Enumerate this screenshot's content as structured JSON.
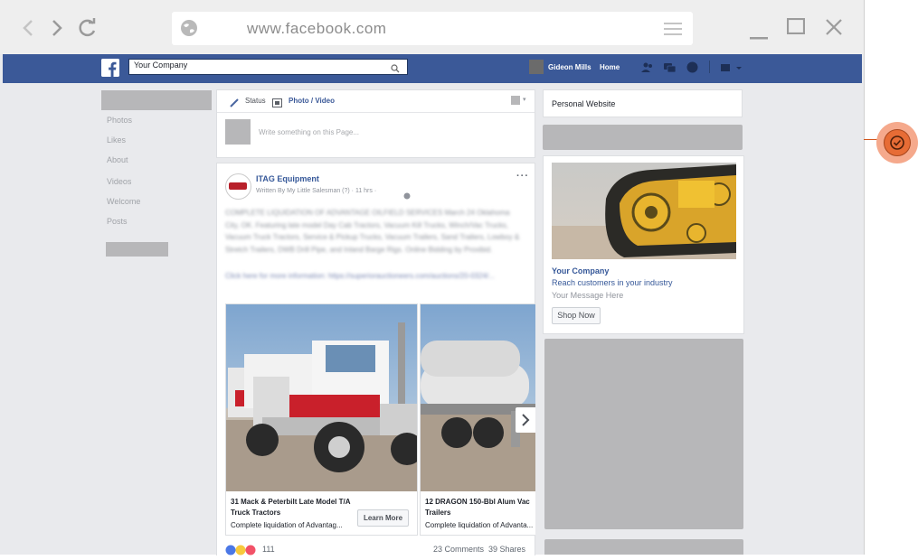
{
  "browser": {
    "url": "www.facebook.com"
  },
  "facebook": {
    "search_value": "Your Company",
    "profile_name": "Gideon Mills",
    "home_label": "Home"
  },
  "left_nav": {
    "items": [
      {
        "label": "Photos"
      },
      {
        "label": "Likes"
      },
      {
        "label": "About"
      },
      {
        "label": "Videos"
      },
      {
        "label": "Welcome"
      },
      {
        "label": "Posts"
      }
    ]
  },
  "composer": {
    "status_label": "Status",
    "photo_video_label": "Photo / Video",
    "placeholder": "Write something on this Page..."
  },
  "post": {
    "page_name": "ITAG Equipment",
    "byline": "Written By My Little Salesman (?) · 11 hrs ·",
    "body": "COMPLETE LIQUIDATION OF ADVANTAGE OILFIELD SERVICES March 24 Oklahoma City, OK. Featuring late model Day Cab Tractors, Vacuum Kill Trucks, Winch/Vac Trucks, Vacuum Truck Tractors, Service & Pickup Trucks, Vacuum Trailers, Sand Trailers, Lowboy & Stretch Trailers, DWB Drill Pipe, and Inland Barge Rigs. Online Bidding by Proxibid.",
    "link_line": "Click here for more information: https://superiorauctioneers.com/auctions/20-0324/...",
    "carousel": [
      {
        "title": "31 Mack & Peterbilt Late Model T/A Truck Tractors",
        "subtitle": "Complete liquidation of Advantag...",
        "cta": "Learn More"
      },
      {
        "title": "12 DRAGON 150-Bbl Alum Vac Trailers",
        "subtitle": "Complete liquidation of Advanta..."
      }
    ],
    "reaction_count": "111",
    "comments": "23 Comments",
    "shares": "39 Shares"
  },
  "right_col": {
    "website_label": "Personal Website",
    "ad": {
      "company": "Your Company",
      "tagline": "Reach customers in your industry",
      "message": "Your Message Here",
      "cta": "Shop Now"
    }
  },
  "colors": {
    "facebook_blue": "#3b5998",
    "annotation_orange": "#e76c35"
  }
}
